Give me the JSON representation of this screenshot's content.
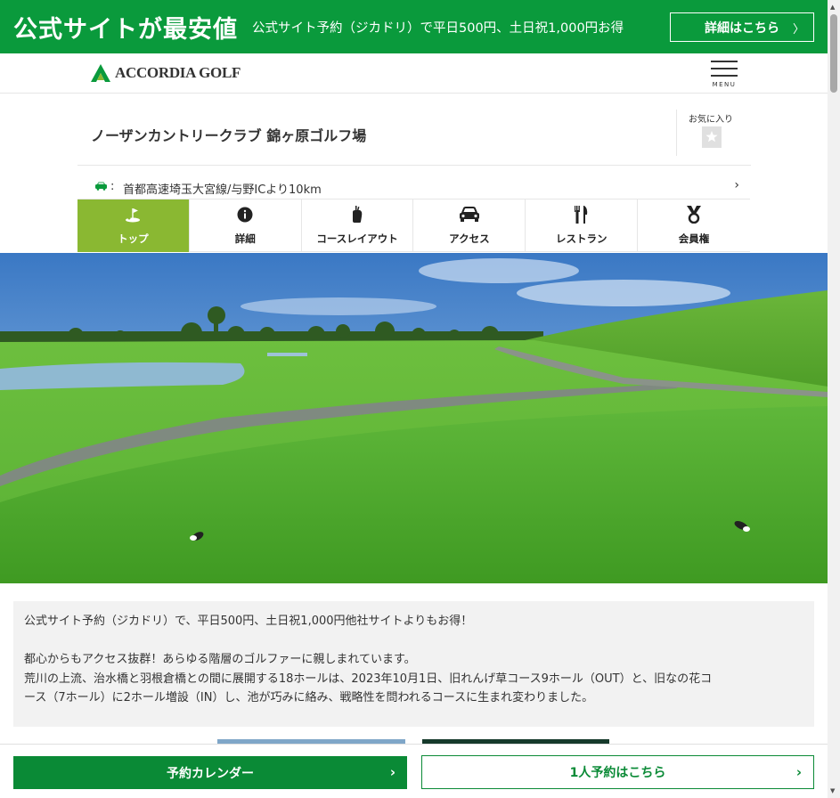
{
  "promo": {
    "title": "公式サイトが最安値",
    "subtitle": "公式サイト予約（ジカドリ）で平日500円、土日祝1,000円お得",
    "detail_button": "詳細はこちら",
    "chevron": "〉"
  },
  "header": {
    "logo_text": "ACCORDIA GOLF",
    "menu_label": "MENU"
  },
  "club": {
    "name": "ノーザンカントリークラブ 錦ヶ原ゴルフ場",
    "favorite_label": "お気に入り"
  },
  "access": {
    "colon": ":",
    "text": "首都高速埼玉大宮線/与野ICより10km",
    "chevron": "›"
  },
  "tabs": [
    {
      "label": "トップ",
      "icon": "golf-flag-icon",
      "active": true
    },
    {
      "label": "詳細",
      "icon": "info-icon",
      "active": false
    },
    {
      "label": "コースレイアウト",
      "icon": "golf-bag-icon",
      "active": false
    },
    {
      "label": "アクセス",
      "icon": "car-icon",
      "active": false
    },
    {
      "label": "レストラン",
      "icon": "fork-knife-icon",
      "active": false
    },
    {
      "label": "会員権",
      "icon": "medal-icon",
      "active": false
    }
  ],
  "description": {
    "line1": "公式サイト予約（ジカドリ）で、平日500円、土日祝1,000円他社サイトよりもお得！",
    "line2": "都心からもアクセス抜群！あらゆる階層のゴルファーに親しまれています。",
    "line3": "荒川の上流、治水橋と羽根倉橋との間に展開する18ホールは、2023年10月1日、旧れんげ草コース9ホール（OUT）と、旧なの花コ",
    "line4": "ース（7ホール）に2ホール増設（IN）し、池が巧みに絡み、戦略性を問われるコースに生まれ変わりました。"
  },
  "actions": {
    "calendar_button": "予約カレンダー",
    "solo_button": "1人予約はこちら",
    "chevron": "›"
  },
  "colors": {
    "brand_green": "#0a9a3c",
    "tab_active": "#8ab832",
    "button_green": "#0a8a36"
  }
}
